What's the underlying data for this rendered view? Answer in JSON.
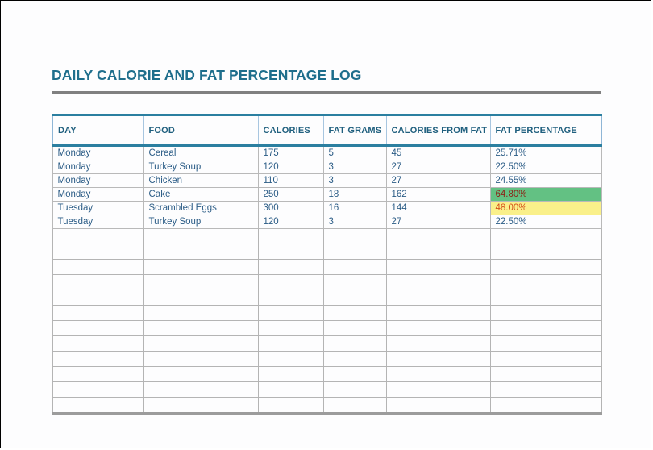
{
  "document": {
    "title": "DAILY CALORIE AND FAT PERCENTAGE LOG"
  },
  "table": {
    "columns": [
      "DAY",
      "FOOD",
      "CALORIES",
      "FAT GRAMS",
      "CALORIES FROM FAT",
      "FAT PERCENTAGE"
    ],
    "rows": [
      {
        "day": "Monday",
        "food": "Cereal",
        "calories": "175",
        "fat_grams": "5",
        "calories_from_fat": "45",
        "fat_percentage": "25.71%",
        "highlight": "none"
      },
      {
        "day": "Monday",
        "food": "Turkey Soup",
        "calories": "120",
        "fat_grams": "3",
        "calories_from_fat": "27",
        "fat_percentage": "22.50%",
        "highlight": "none"
      },
      {
        "day": "Monday",
        "food": "Chicken",
        "calories": "110",
        "fat_grams": "3",
        "calories_from_fat": "27",
        "fat_percentage": "24.55%",
        "highlight": "none"
      },
      {
        "day": "Monday",
        "food": "Cake",
        "calories": "250",
        "fat_grams": "18",
        "calories_from_fat": "162",
        "fat_percentage": "64.80%",
        "highlight": "green"
      },
      {
        "day": "Tuesday",
        "food": "Scrambled Eggs",
        "calories": "300",
        "fat_grams": "16",
        "calories_from_fat": "144",
        "fat_percentage": "48.00%",
        "highlight": "yellow"
      },
      {
        "day": "Tuesday",
        "food": "Turkey Soup",
        "calories": "120",
        "fat_grams": "3",
        "calories_from_fat": "27",
        "fat_percentage": "22.50%",
        "highlight": "none"
      }
    ],
    "empty_row_count": 12
  },
  "colors": {
    "title": "#1e6e8c",
    "header_text": "#1f5f7e",
    "header_rule": "#2b7fa0",
    "title_rule": "#808080",
    "cell_text": "#2b5c86",
    "grid": "#b4b4b4",
    "highlight_green_bg": "#63c183",
    "highlight_green_text": "#8c2318",
    "highlight_yellow_bg": "#faf08a",
    "highlight_yellow_text": "#d4521a",
    "page_border": "#000000"
  }
}
